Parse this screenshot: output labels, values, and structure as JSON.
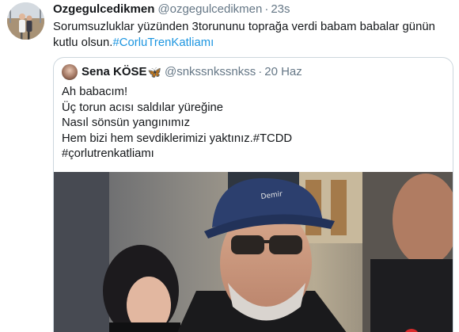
{
  "tweet": {
    "display_name": "Ozgegulcedikmen",
    "handle": "@ozgegulcedikmen",
    "separator": "·",
    "time": "23s",
    "text": "Sorumsuzluklar yüzünden 3torununu toprağa verdi babam babalar günün kutlu olsun.",
    "hashtag": "#CorluTrenKatliamı",
    "avatar_icon": "user-avatar"
  },
  "quoted_tweet": {
    "display_name": "Sena KÖSE",
    "emoji": "🦋",
    "handle": "@snkssnkssnkss",
    "separator": "·",
    "time": "20 Haz",
    "lines": [
      "Ah babacım!",
      "Üç torun acısı saldılar yüreğine",
      "Nasıl sönsün yangınımız",
      "Hem bizi hem sevdiklerimizi yaktınız.#TCDD",
      "#çorlutrenkatliamı"
    ],
    "photo_icon": "photo-image"
  },
  "colors": {
    "accent": "#1b95e0",
    "secondary_text": "#657786",
    "border": "#ccd6dd"
  }
}
